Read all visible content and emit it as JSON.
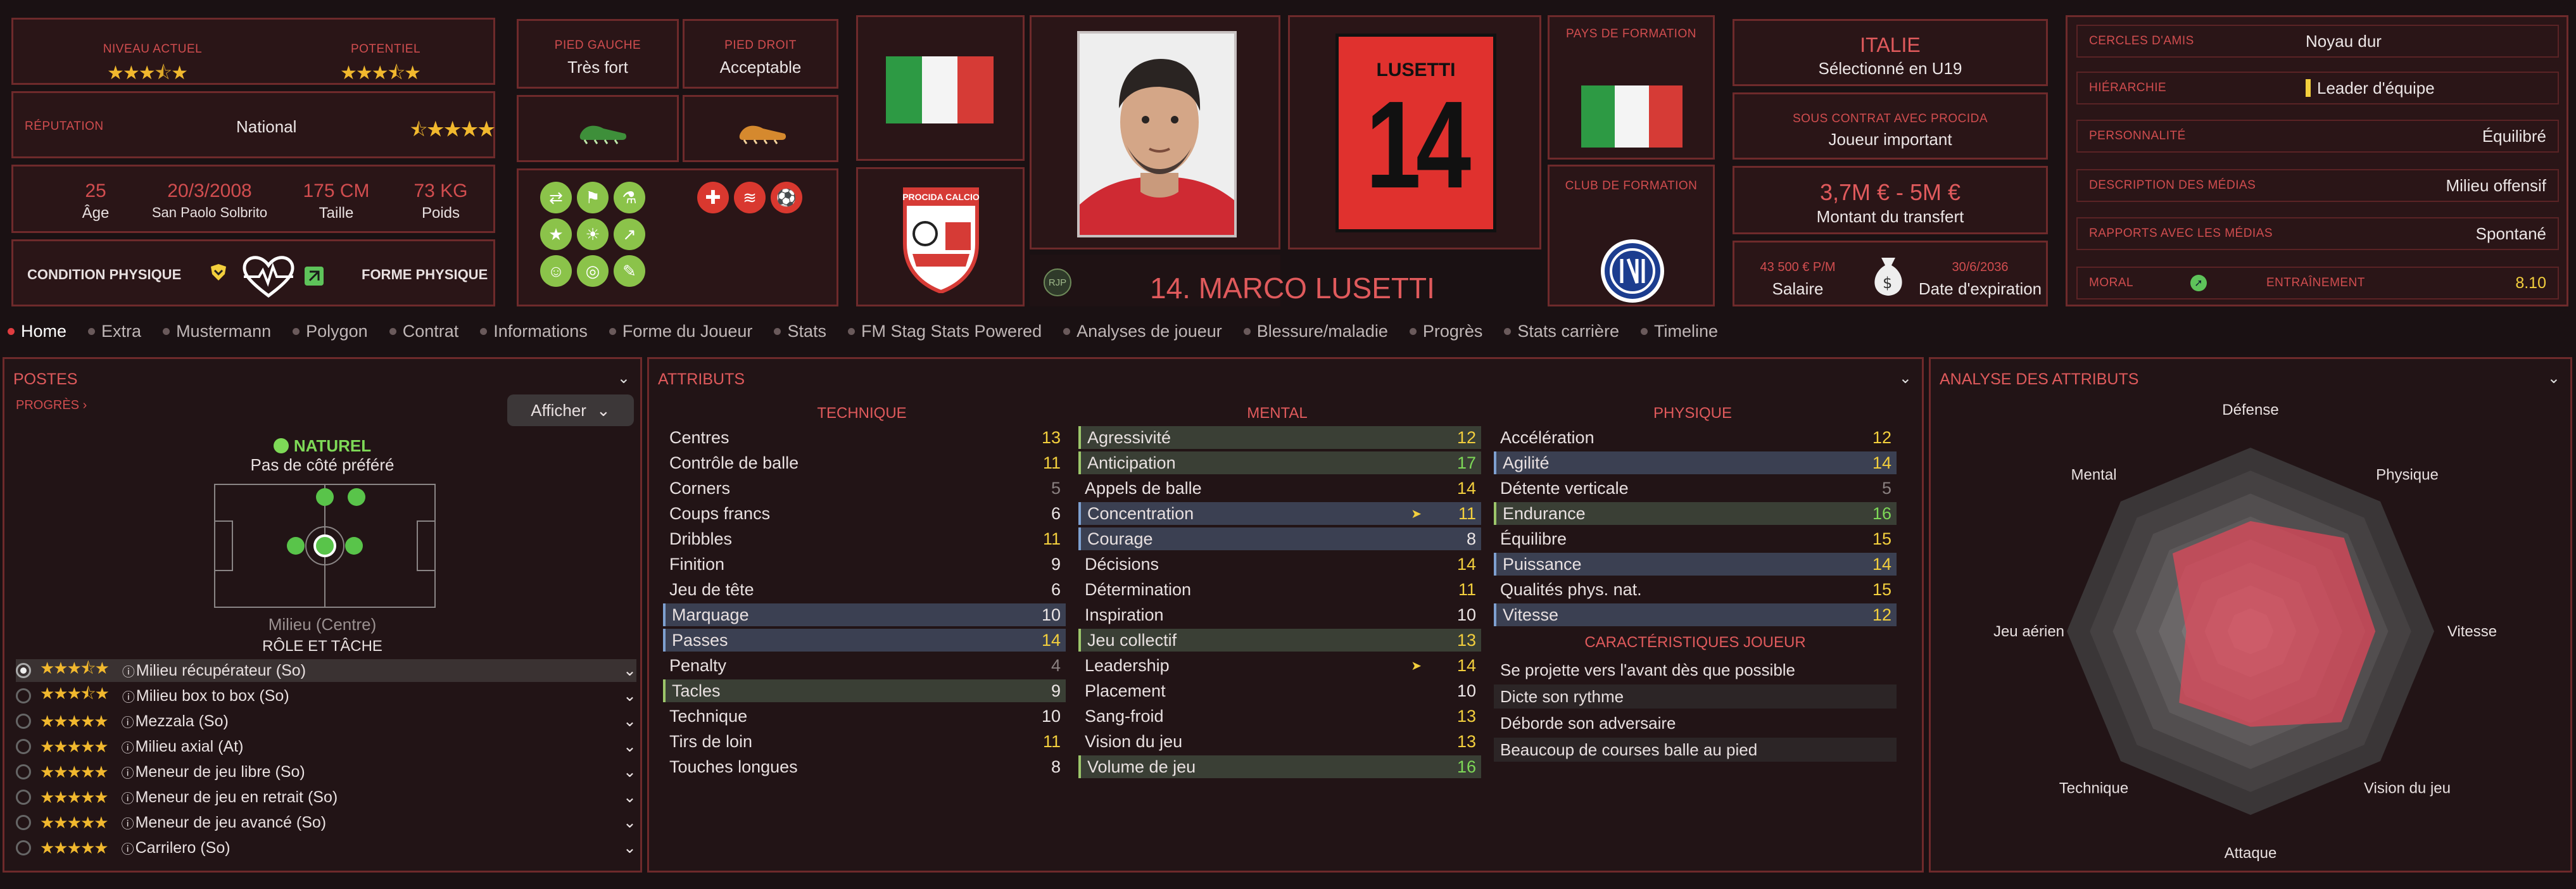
{
  "header": {
    "niveau_actuel": "NIVEAU ACTUEL",
    "potentiel": "POTENTIEL",
    "reputation_label": "RÉPUTATION",
    "reputation_value": "National",
    "age": "25",
    "age_label": "Âge",
    "birth": "20/3/2008",
    "birthplace": "San Paolo Solbrito",
    "height": "175 CM",
    "height_label": "Taille",
    "weight": "73 KG",
    "weight_label": "Poids",
    "condition_label": "CONDITION PHYSIQUE",
    "forme_label": "FORME PHYSIQUE",
    "pied_gauche_label": "PIED GAUCHE",
    "pied_gauche_value": "Très fort",
    "pied_droit_label": "PIED DROIT",
    "pied_droit_value": "Acceptable",
    "player_name": "14. MARCO LUSETTI",
    "shirt_name": "LUSETTI",
    "shirt_number": "14",
    "rjp": "RJP",
    "pays_formation_label": "PAYS DE FORMATION",
    "club_formation_label": "CLUB DE FORMATION",
    "club_badge_text": "PROCIDA CALCIO",
    "nation": "ITALIE",
    "nation_sub": "Sélectionné en U19",
    "contract_label": "SOUS CONTRAT AVEC PROCIDA",
    "contract_value": "Joueur important",
    "transfer_value": "3,7M € - 5M €",
    "transfer_label": "Montant du transfert",
    "salary_value": "43 500 € P/M",
    "salary_label": "Salaire",
    "expiry_value": "30/6/2036",
    "expiry_label": "Date d'expiration",
    "stars_current": 3.5,
    "stars_potential": 3.5,
    "reputation_stars": 1.5
  },
  "info": [
    {
      "label": "CERCLES D'AMIS",
      "value": "Noyau dur"
    },
    {
      "label": "HIÉRARCHIE",
      "value": "Leader d'équipe"
    },
    {
      "label": "PERSONNALITÉ",
      "value": "Équilibré"
    },
    {
      "label": "DESCRIPTION DES MÉDIAS",
      "value": "Milieu offensif"
    },
    {
      "label": "RAPPORTS AVEC LES MÉDIAS",
      "value": "Spontané"
    }
  ],
  "moral_label": "MORAL",
  "entrainement_label": "ENTRAÎNEMENT",
  "entrainement_value": "8.10",
  "tabs": [
    "Home",
    "Extra",
    "Mustermann",
    "Polygon",
    "Contrat",
    "Informations",
    "Forme du Joueur",
    "Stats",
    "FM Stag Stats Powered",
    "Analyses de joueur",
    "Blessure/maladie",
    "Progrès",
    "Stats carrière",
    "Timeline"
  ],
  "postes": {
    "title": "POSTES",
    "progress": "PROGRÈS",
    "afficher": "Afficher",
    "naturel": "NATUREL",
    "side": "Pas de côté préféré",
    "position": "Milieu (Centre)",
    "role_title": "RÔLE ET TÂCHE",
    "roles": [
      {
        "name": "Milieu récupérateur (So)",
        "stars": 3.5
      },
      {
        "name": "Milieu box to box (So)",
        "stars": 3.5
      },
      {
        "name": "Mezzala (So)",
        "stars": 3
      },
      {
        "name": "Milieu axial (At)",
        "stars": 3
      },
      {
        "name": "Meneur de jeu libre (So)",
        "stars": 3
      },
      {
        "name": "Meneur de jeu en retrait (So)",
        "stars": 3
      },
      {
        "name": "Meneur de jeu avancé (So)",
        "stars": 3
      },
      {
        "name": "Carrilero (So)",
        "stars": 3
      }
    ]
  },
  "attributs": {
    "title": "ATTRIBUTS",
    "technique_title": "TECHNIQUE",
    "mental_title": "MENTAL",
    "physique_title": "PHYSIQUE",
    "carac_title": "CARACTÉRISTIQUES JOUEUR",
    "technique": [
      [
        "Centres",
        "13"
      ],
      [
        "Contrôle de balle",
        "11"
      ],
      [
        "Corners",
        "5"
      ],
      [
        "Coups francs",
        "6"
      ],
      [
        "Dribbles",
        "11"
      ],
      [
        "Finition",
        "9"
      ],
      [
        "Jeu de tête",
        "6"
      ],
      [
        "Marquage",
        "10"
      ],
      [
        "Passes",
        "14"
      ],
      [
        "Penalty",
        "4"
      ],
      [
        "Tacles",
        "9"
      ],
      [
        "Technique",
        "10"
      ],
      [
        "Tirs de loin",
        "11"
      ],
      [
        "Touches longues",
        "8"
      ]
    ],
    "mental": [
      [
        "Agressivité",
        "12"
      ],
      [
        "Anticipation",
        "17"
      ],
      [
        "Appels de balle",
        "14"
      ],
      [
        "Concentration",
        "11"
      ],
      [
        "Courage",
        "8"
      ],
      [
        "Décisions",
        "14"
      ],
      [
        "Détermination",
        "11"
      ],
      [
        "Inspiration",
        "10"
      ],
      [
        "Jeu collectif",
        "13"
      ],
      [
        "Leadership",
        "14"
      ],
      [
        "Placement",
        "10"
      ],
      [
        "Sang-froid",
        "13"
      ],
      [
        "Vision du jeu",
        "13"
      ],
      [
        "Volume de jeu",
        "16"
      ]
    ],
    "physique": [
      [
        "Accélération",
        "12"
      ],
      [
        "Agilité",
        "14"
      ],
      [
        "Détente verticale",
        "5"
      ],
      [
        "Endurance",
        "16"
      ],
      [
        "Équilibre",
        "15"
      ],
      [
        "Puissance",
        "14"
      ],
      [
        "Qualités phys. nat.",
        "15"
      ],
      [
        "Vitesse",
        "12"
      ]
    ],
    "carac": [
      "Se projette vers l'avant dès que possible",
      "Dicte son rythme",
      "Déborde son adversaire",
      "Beaucoup de courses balle au pied"
    ]
  },
  "analyse": {
    "title": "ANALYSE DES ATTRIBUTS",
    "axes": [
      "Défense",
      "Physique",
      "Vitesse",
      "Vision du jeu",
      "Attaque",
      "Technique",
      "Jeu aérien",
      "Mental"
    ],
    "values": [
      0.6,
      0.72,
      0.68,
      0.7,
      0.52,
      0.55,
      0.35,
      0.6
    ],
    "player_color": "#e3485a"
  },
  "colors": {
    "accent": "#d14d4f",
    "bg": "#1a1113",
    "panel": "#2a1517",
    "star": "#f1b82e",
    "green": "#7ed957",
    "yellow": "#f3cf3d"
  }
}
